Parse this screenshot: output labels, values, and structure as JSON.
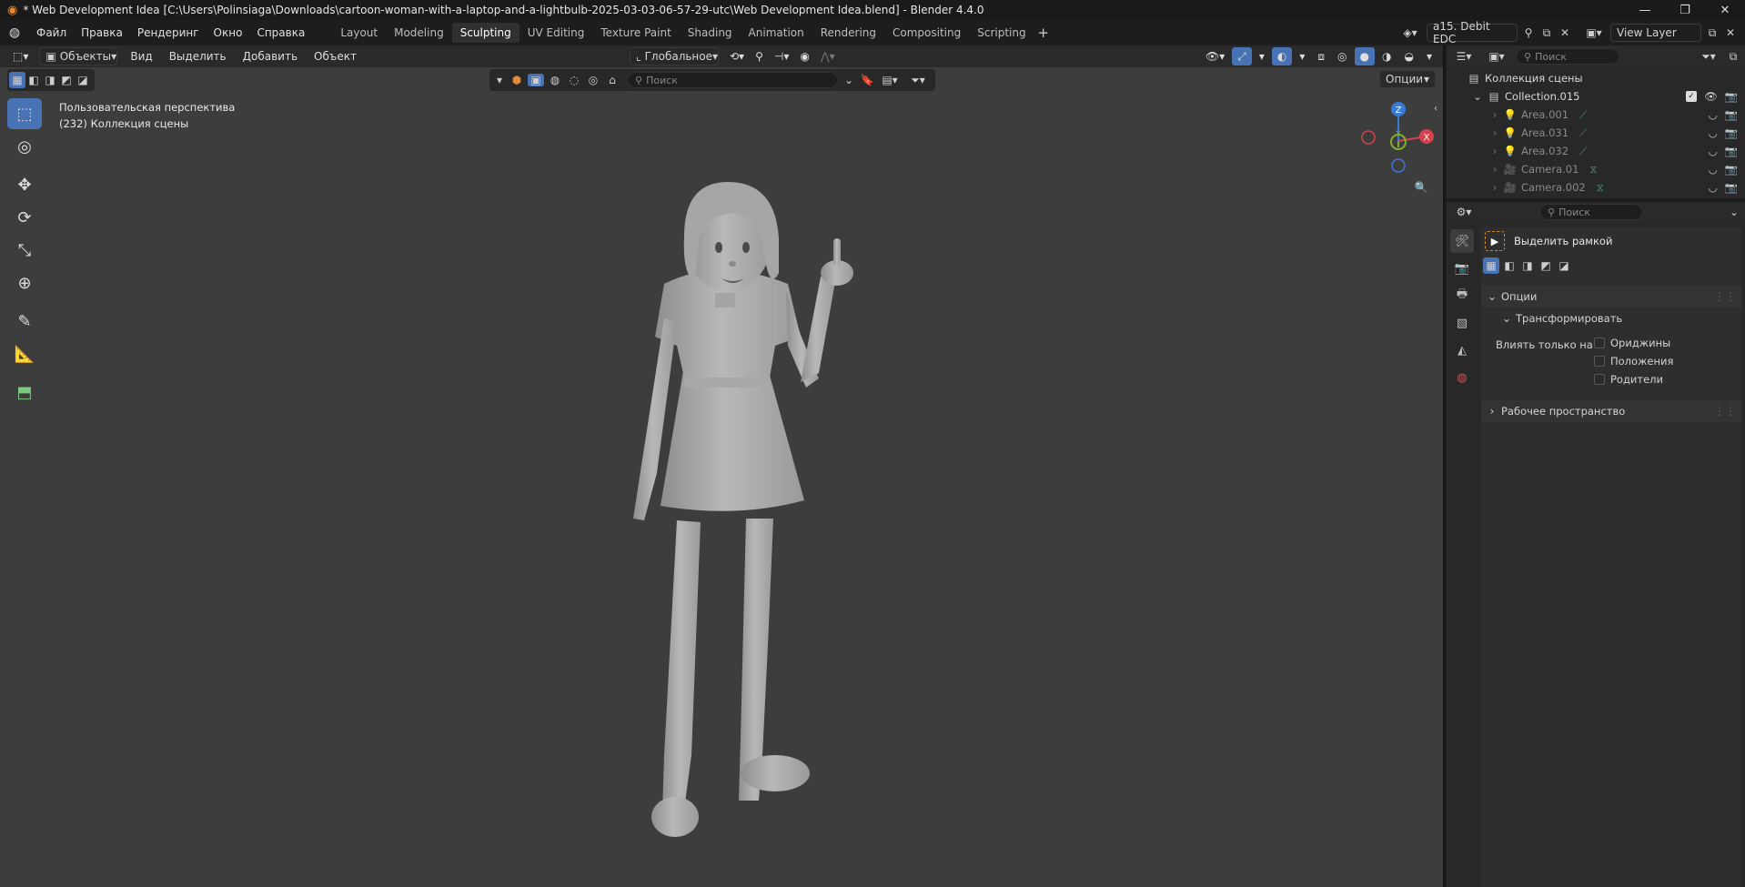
{
  "window": {
    "title": "* Web Development Idea [C:\\Users\\Polinsiaga\\Downloads\\cartoon-woman-with-a-laptop-and-a-lightbulb-2025-03-03-06-57-29-utc\\Web Development Idea.blend] - Blender 4.4.0"
  },
  "menu": [
    "Файл",
    "Правка",
    "Рендеринг",
    "Окно",
    "Справка"
  ],
  "workspaces": [
    "Layout",
    "Modeling",
    "Sculpting",
    "UV Editing",
    "Texture Paint",
    "Shading",
    "Animation",
    "Rendering",
    "Compositing",
    "Scripting"
  ],
  "active_workspace": "Sculpting",
  "scene": {
    "name": "a15. Debit EDC",
    "view_layer": "View Layer"
  },
  "viewport_header": {
    "mode": "Объекты",
    "menus": [
      "Вид",
      "Выделить",
      "Добавить",
      "Объект"
    ],
    "transform_orientation": "Глобальное",
    "options_label": "Опции",
    "search_placeholder": "Поиск"
  },
  "viewport_overlay": {
    "line1": "Пользовательская перспектива",
    "line2": "(232) Коллекция сцены"
  },
  "gizmo": {
    "x": "X",
    "y": "Y",
    "z": "Z"
  },
  "outliner": {
    "search_placeholder": "Поиск",
    "root": "Коллекция сцены",
    "collection": "Collection.015",
    "items": [
      "Area.001",
      "Area.031",
      "Area.032",
      "Camera.01",
      "Camera.002"
    ]
  },
  "properties": {
    "search_placeholder": "Поиск",
    "tool_name": "Выделить рамкой",
    "section_options": "Опции",
    "subsection_transform": "Трансформировать",
    "affect_only_label": "Влиять только на",
    "checkboxes": [
      "Ориджины",
      "Положения",
      "Родители"
    ],
    "section_workspace": "Рабочее пространство"
  },
  "colors": {
    "accent": "#4772b3",
    "viewport_bg": "#3d3d3d",
    "x_axis": "#d6424e",
    "y_axis": "#7fb02b",
    "z_axis": "#3b79d6"
  }
}
